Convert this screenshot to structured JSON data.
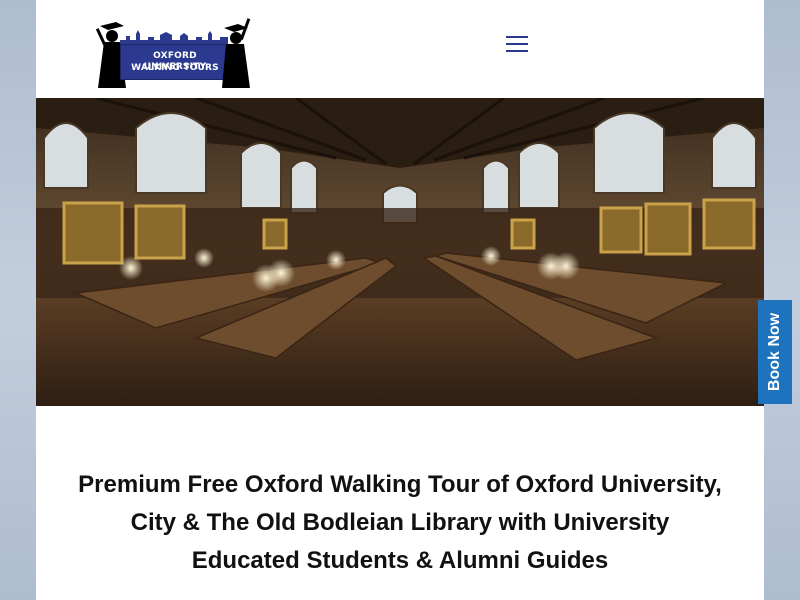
{
  "logo": {
    "line1": "OXFORD UNIVERSITY",
    "line2": "WALKING TOURS"
  },
  "header": {
    "menu_icon": "hamburger-menu-icon"
  },
  "hero": {
    "image": "great-hall-dining-room-photo"
  },
  "main": {
    "headline": "Premium Free Oxford Walking Tour of Oxford University, City & The Old Bodleian Library with University Educated Students & Alumni Guides"
  },
  "book_now": {
    "label": "Book Now"
  },
  "colors": {
    "brand_blue": "#2b3a8f",
    "book_now_bg": "#1e73be"
  }
}
